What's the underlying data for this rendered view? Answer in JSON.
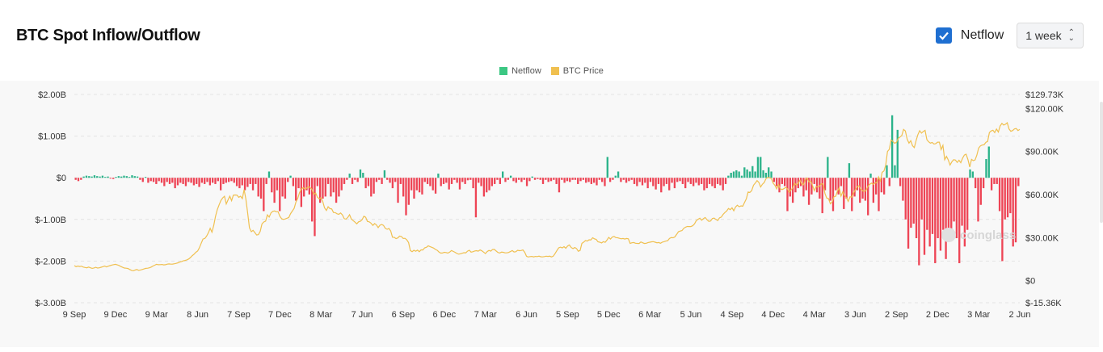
{
  "header": {
    "title": "BTC Spot Inflow/Outflow",
    "netflow_checkbox_label": "Netflow",
    "netflow_checked": true,
    "range_select_value": "1 week"
  },
  "legend": [
    {
      "label": "Netflow",
      "color": "#3cc783"
    },
    {
      "label": "BTC Price",
      "color": "#f0c050"
    }
  ],
  "watermark": "coinglass",
  "colors": {
    "positive": "#2bb38a",
    "negative": "#ee4455",
    "price": "#f0c050",
    "accent": "#1f6fd1"
  },
  "chart_data": {
    "type": "bar",
    "left_axis": {
      "min": -3.0,
      "max": 2.0,
      "ticks": [
        {
          "v": 2.0,
          "label": "$2.00B"
        },
        {
          "v": 1.0,
          "label": "$1.00B"
        },
        {
          "v": 0,
          "label": "$0"
        },
        {
          "v": -1.0,
          "label": "$-1.00B"
        },
        {
          "v": -2.0,
          "label": "$-2.00B"
        },
        {
          "v": -3.0,
          "label": "$-3.00B"
        }
      ]
    },
    "right_axis": {
      "min": -15.36,
      "max": 129.73,
      "ticks": [
        {
          "v": 129.73,
          "label": "$129.73K"
        },
        {
          "v": 120,
          "label": "$120.00K"
        },
        {
          "v": 90,
          "label": "$90.00K"
        },
        {
          "v": 60,
          "label": "$60.00K"
        },
        {
          "v": 30,
          "label": "$30.00K"
        },
        {
          "v": 0,
          "label": "$0"
        },
        {
          "v": -15.36,
          "label": "$-15.36K"
        }
      ]
    },
    "x_labels": [
      "9 Sep",
      "9 Dec",
      "9 Mar",
      "8 Jun",
      "7 Sep",
      "7 Dec",
      "8 Mar",
      "7 Jun",
      "6 Sep",
      "6 Dec",
      "7 Mar",
      "6 Jun",
      "5 Sep",
      "5 Dec",
      "6 Mar",
      "5 Jun",
      "4 Sep",
      "4 Dec",
      "4 Mar",
      "3 Jun",
      "2 Sep",
      "2 Dec",
      "3 Mar",
      "2 Jun"
    ],
    "series": [
      {
        "name": "Netflow",
        "unit": "B USD",
        "values": [
          -0.05,
          -0.08,
          -0.05,
          0.03,
          0.05,
          0.04,
          0.03,
          0.06,
          0.04,
          0.03,
          0.05,
          0.02,
          0.03,
          -0.02,
          -0.03,
          0.02,
          0.04,
          0.03,
          0.05,
          0.04,
          0.02,
          0.06,
          0.04,
          0.03,
          -0.05,
          -0.1,
          0.02,
          -0.12,
          -0.08,
          -0.1,
          -0.15,
          -0.08,
          -0.12,
          -0.2,
          -0.1,
          -0.15,
          -0.12,
          -0.25,
          -0.18,
          -0.12,
          -0.15,
          -0.2,
          -0.1,
          -0.12,
          -0.18,
          -0.15,
          -0.22,
          -0.12,
          -0.15,
          -0.1,
          -0.18,
          -0.12,
          -0.15,
          -0.08,
          -0.3,
          -0.15,
          -0.12,
          -0.1,
          -0.08,
          -0.12,
          -0.2,
          -0.25,
          -0.18,
          -0.3,
          -0.22,
          -0.15,
          -0.3,
          -0.15,
          -0.45,
          -0.5,
          -0.8,
          -0.15,
          0.15,
          -0.35,
          -0.6,
          -0.3,
          -0.8,
          -0.45,
          -0.5,
          -0.1,
          0.05,
          -0.2,
          -0.55,
          -0.25,
          -0.7,
          -0.45,
          -0.3,
          -0.4,
          -1.05,
          -1.4,
          -0.2,
          -0.6,
          -0.5,
          -0.45,
          -0.15,
          -0.45,
          -0.35,
          -0.6,
          -0.45,
          -0.3,
          -0.15,
          -0.05,
          0.1,
          -0.15,
          -0.05,
          -0.1,
          0.2,
          0.12,
          -0.25,
          -0.2,
          -0.45,
          -0.38,
          -0.1,
          -0.05,
          -0.15,
          0.18,
          -0.05,
          -0.12,
          -0.25,
          -0.1,
          -0.6,
          -0.15,
          -0.45,
          -0.9,
          -0.65,
          -0.3,
          -0.5,
          -0.3,
          -0.35,
          -0.4,
          -0.1,
          -0.15,
          -0.2,
          -0.3,
          -0.38,
          0.1,
          -0.2,
          -0.15,
          -0.12,
          -0.28,
          -0.15,
          -0.05,
          -0.12,
          -0.28,
          -0.1,
          -0.15,
          -0.06,
          -0.05,
          -0.25,
          -0.95,
          -0.12,
          -0.2,
          -0.45,
          -0.35,
          -0.3,
          -0.2,
          -0.15,
          -0.05,
          -0.15,
          0.15,
          -0.1,
          -0.05,
          0.05,
          -0.08,
          -0.12,
          -0.05,
          -0.1,
          -0.05,
          -0.2,
          -0.08,
          0.03,
          -0.05,
          -0.03,
          -0.05,
          -0.15,
          -0.05,
          -0.1,
          -0.08,
          -0.05,
          -0.15,
          -0.35,
          -0.05,
          -0.12,
          -0.08,
          -0.1,
          -0.05,
          -0.05,
          -0.15,
          -0.08,
          -0.05,
          -0.12,
          -0.1,
          -0.15,
          -0.12,
          -0.18,
          -0.05,
          -0.1,
          -0.2,
          0.5,
          -0.1,
          -0.05,
          0.05,
          0.15,
          -0.1,
          -0.05,
          -0.12,
          -0.08,
          -0.05,
          -0.15,
          -0.2,
          -0.1,
          -0.18,
          -0.12,
          -0.25,
          -0.1,
          -0.2,
          -0.28,
          -0.15,
          -0.35,
          -0.2,
          -0.15,
          -0.3,
          -0.12,
          -0.25,
          -0.1,
          -0.08,
          -0.15,
          -0.25,
          -0.1,
          -0.15,
          -0.2,
          -0.12,
          -0.18,
          -0.15,
          -0.3,
          -0.25,
          -0.15,
          -0.2,
          -0.25,
          -0.15,
          -0.18,
          -0.3,
          -0.15,
          0.05,
          0.12,
          0.15,
          0.18,
          0.15,
          0.05,
          0.25,
          0.2,
          0.15,
          0.28,
          0.15,
          0.5,
          0.5,
          0.18,
          0.12,
          0.25,
          0.15,
          -0.1,
          -0.2,
          -0.35,
          -0.15,
          -0.2,
          -0.8,
          -0.45,
          -0.6,
          -0.35,
          -0.25,
          -0.2,
          -0.45,
          -0.3,
          -0.65,
          -0.4,
          -0.15,
          -0.35,
          -0.5,
          -0.85,
          -0.3,
          0.5,
          -0.55,
          -0.8,
          -0.3,
          -0.4,
          -0.2,
          -0.75,
          -0.5,
          0.35,
          -0.8,
          -0.45,
          -0.3,
          -0.6,
          -0.5,
          -0.55,
          -0.9,
          0.1,
          -0.6,
          -0.4,
          -0.8,
          -0.35,
          -0.4,
          0.3,
          -0.2,
          1.5,
          0.3,
          1.15,
          -0.2,
          -0.55,
          -1.0,
          -1.7,
          -1.2,
          -1.1,
          -1.45,
          -2.1,
          -1.0,
          -1.85,
          -1.25,
          -1.65,
          -1.35,
          -2.05,
          -1.45,
          -1.75,
          -1.25,
          -1.95,
          -1.25,
          -1.35,
          -1.05,
          -1.45,
          -2.05,
          -1.15,
          -1.65,
          -1.25,
          0.2,
          0.15,
          -0.25,
          -1.05,
          -0.65,
          -0.25,
          0.45,
          0.75,
          -0.3,
          -0.15,
          -0.15,
          -0.8,
          -2.0,
          -1.0,
          -0.95,
          -0.85,
          -1.65,
          -1.55,
          -0.2
        ]
      },
      {
        "name": "BTC Price",
        "unit": "K USD",
        "values": [
          10.5,
          9.8,
          10.2,
          9.9,
          10.1,
          9.5,
          9.2,
          9.0,
          9.5,
          9.0,
          8.6,
          8.9,
          9.3,
          8.8,
          9.0,
          9.4,
          9.8,
          10.2,
          9.6,
          10.1,
          10.5,
          10.9,
          11.2,
          11.4,
          11.0,
          10.6,
          9.9,
          9.3,
          8.8,
          8.7,
          8.5,
          7.8,
          7.2,
          6.9,
          7.4,
          7.8,
          7.2,
          7.5,
          7.8,
          8.2,
          8.6,
          8.7,
          9.0,
          9.5,
          10.2,
          10.8,
          11.4,
          11.1,
          11.2,
          11.3,
          11.0,
          11.1,
          11.5,
          11.7,
          11.5,
          11.6,
          11.8,
          12.1,
          12.5,
          13.0,
          13.4,
          13.8,
          14.1,
          14.5,
          15.2,
          16.2,
          17.5,
          18.5,
          19.8,
          20.7,
          23.0,
          26.1,
          29.0,
          29.4,
          31.1,
          33.4,
          36.5,
          33.8,
          38.5,
          44.8,
          49.5,
          52.8,
          55.9,
          57.7,
          58.8,
          53.5,
          56.3,
          58.9,
          55.7,
          59.6,
          59.7,
          59.6,
          58.1,
          58.9,
          57.2,
          63.5,
          56.8,
          47.1,
          36.8,
          34.1,
          35.1,
          33.5,
          31.8,
          32.1,
          34.3,
          39.5,
          40.9,
          41.5,
          45.8,
          44.3,
          47.2,
          48.3,
          48.6,
          48.0,
          48.1,
          44.9,
          43.1,
          42.7,
          43.0,
          43.5,
          44.0,
          46.7,
          48.5,
          50.4,
          54.9,
          57.4,
          61.4,
          63.7,
          64.9,
          63.8,
          64.5,
          65.5,
          64.9,
          63.5,
          60.1,
          61.1,
          58.2,
          57.1,
          57.8,
          55.2,
          50.8,
          48.9,
          51.5,
          50.2,
          50.0,
          47.5,
          47.4,
          46.6,
          46.2,
          47.2,
          45.8,
          43.2,
          42.9,
          44.1,
          46.0,
          42.9,
          41.9,
          40.8,
          39.6,
          41.0,
          41.4,
          42.5,
          44.9,
          44.2,
          41.3,
          41.0,
          40.1,
          38.5,
          39.8,
          38.9,
          37.0,
          38.6,
          39.2,
          38.5,
          36.5,
          35.8,
          36.4,
          34.7,
          30.3,
          30.2,
          29.3,
          29.8,
          31.1,
          30.8,
          29.4,
          29.5,
          28.5,
          26.6,
          21.0,
          20.2,
          21.2,
          20.5,
          21.3,
          20.2,
          21.5,
          21.4,
          22.9,
          23.3,
          24.3,
          23.8,
          23.3,
          22.7,
          21.8,
          21.2,
          20.0,
          19.2,
          19.3,
          19.8,
          19.6,
          19.2,
          19.9,
          21.0,
          20.4,
          19.8,
          19.0,
          18.5,
          18.7,
          19.1,
          19.5,
          19.4,
          20.6,
          21.2,
          19.9,
          20.2,
          20.7,
          20.9,
          20.6,
          21.4,
          20.8,
          19.9,
          18.9,
          20.3,
          21.1,
          20.6,
          21.7,
          21.8,
          20.7,
          19.7,
          19.3,
          19.9,
          19.8,
          19.4,
          19.4,
          19.7,
          20.3,
          21.0,
          20.0,
          20.2,
          21.2,
          20.9,
          21.0,
          21.4,
          19.8,
          17.0,
          16.5,
          16.8,
          16.9,
          16.6,
          16.9,
          16.8,
          17.1,
          16.7,
          16.6,
          16.8,
          17.1,
          16.9,
          17.1,
          16.6,
          17.1,
          19.0,
          21.0,
          22.9,
          23.4,
          22.8,
          23.7,
          22.6,
          24.2,
          24.9,
          23.1,
          22.4,
          23.1,
          22.4,
          20.5,
          21.1,
          26.0,
          26.9,
          28.0,
          27.6,
          28.5,
          28.4,
          29.9,
          29.2,
          28.8,
          27.1,
          26.8,
          26.3,
          27.2,
          26.7,
          28.3,
          30.2,
          29.0,
          30.4,
          30.8,
          30.0,
          29.9,
          29.5,
          29.2,
          29.4,
          29.0,
          29.4,
          29.2,
          26.0,
          26.4,
          26.6,
          26.1,
          26.0,
          25.9,
          27.0,
          26.4,
          25.9,
          26.1,
          26.6,
          26.8,
          27.1,
          27.2,
          26.8,
          26.4,
          26.6,
          26.1,
          26.9,
          27.2,
          27.6,
          27.9,
          29.4,
          30.0,
          29.9,
          30.5,
          32.2,
          34.1,
          34.6,
          34.9,
          36.5,
          37.3,
          37.8,
          37.7,
          37.7,
          38.3,
          39.6,
          41.9,
          42.8,
          43.5,
          42.1,
          43.2,
          44.0,
          42.5,
          41.3,
          41.6,
          43.3,
          43.6,
          42.7,
          41.9,
          43.8,
          44.3,
          46.2,
          47.5,
          48.5,
          50.3,
          49.5,
          50.8,
          48.7,
          51.4,
          52.6,
          51.5,
          52.1,
          51.9,
          54.5,
          57.0,
          61.8,
          61.5,
          62.7,
          66.5,
          68.0,
          69.7,
          68.5,
          65.3,
          67.2,
          68.4,
          71.0,
          71.9,
          71.7,
          71.2,
          67.9,
          66.4,
          64.0,
          66.9,
          64.1,
          63.5,
          64.1,
          65.0,
          64.0,
          61.6,
          63.2,
          64.7,
          67.8,
          66.6,
          67.8,
          70.0,
          67.5,
          66.8,
          70.6,
          71.5,
          68.8,
          69.4,
          66.6,
          62.7,
          65.5,
          65.3,
          65.9,
          67.6,
          67.3,
          60.7,
          57.5,
          57.2,
          53.6,
          54.8,
          58.5,
          58.8,
          62.6,
          64.8,
          59.0,
          62.0,
          59.2,
          57.7,
          55.2,
          58.4,
          58.2,
          61.1,
          63.3,
          65.4,
          66.1,
          63.9,
          62.7,
          62.2,
          62.9,
          65.7,
          67.0,
          68.0,
          67.0,
          68.1,
          68.3,
          72.3,
          69.5,
          75.5,
          76.4,
          80.4,
          90.0,
          91.5,
          98.0,
          97.0,
          95.7,
          96.4,
          99.1,
          100.1,
          101.1,
          105.4,
          104.3,
          98.5,
          95.8,
          97.5,
          94.0,
          92.7,
          97.6,
          101.7,
          104.5,
          102.8,
          104.0,
          104.7,
          98.3,
          96.8,
          95.8,
          96.3,
          95.2,
          95.5,
          96.5,
          96.5,
          91.4,
          94.3,
          84.3,
          86.6,
          84.1,
          80.6,
          82.9,
          84.3,
          84.0,
          82.4,
          83.9,
          82.2,
          85.3,
          87.5,
          88.1,
          84.3,
          79.2,
          84.5,
          83.6,
          84.1,
          87.5,
          92.4,
          93.9,
          94.5,
          94.7,
          96.3,
          97.0,
          103.2,
          104.3,
          104.8,
          103.2,
          105.6,
          103.5,
          107.8,
          109.6,
          108.4,
          109.0,
          110.0,
          105.7,
          104.1,
          104.6,
          105.7,
          106.0,
          104.6,
          105.4
        ]
      }
    ]
  }
}
